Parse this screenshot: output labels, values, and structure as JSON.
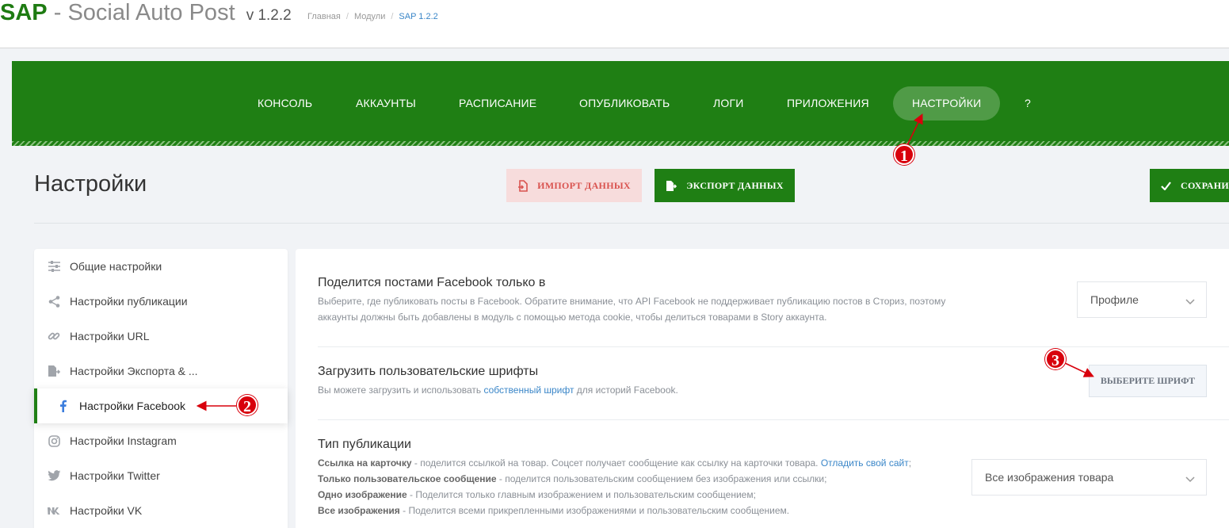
{
  "header": {
    "brand": "SAP",
    "separator": "-",
    "name": "Social Auto Post",
    "version": "v 1.2.2",
    "breadcrumb": [
      "Главная",
      "Модули",
      "SAP 1.2.2"
    ]
  },
  "nav": {
    "items": [
      "КОНСОЛЬ",
      "АККАУНТЫ",
      "РАСПИСАНИЕ",
      "ОПУБЛИКОВАТЬ",
      "ЛОГИ",
      "ПРИЛОЖЕНИЯ",
      "НАСТРОЙКИ",
      "?"
    ],
    "active": "НАСТРОЙКИ"
  },
  "page": {
    "title": "Настройки",
    "import_label": "ИМПОРТ ДАННЫХ",
    "export_label": "ЭКСПОРТ ДАННЫХ",
    "save_label": "СОХРАНИ"
  },
  "sidebar": {
    "items": [
      {
        "label": "Общие настройки",
        "icon": "sliders-icon"
      },
      {
        "label": "Настройки публикации",
        "icon": "share-icon"
      },
      {
        "label": "Настройки URL",
        "icon": "link-icon"
      },
      {
        "label": "Настройки Экспорта & ...",
        "icon": "file-export-icon"
      },
      {
        "label": "Настройки Facebook",
        "icon": "facebook-icon"
      },
      {
        "label": "Настройки Instagram",
        "icon": "instagram-icon"
      },
      {
        "label": "Настройки Twitter",
        "icon": "twitter-icon"
      },
      {
        "label": "Настройки VK",
        "icon": "vk-icon"
      }
    ],
    "active": "Настройки Facebook"
  },
  "settings": {
    "share_only": {
      "title": "Поделится постами Facebook только в",
      "desc_line1": "Выберите, где публиковать посты в Facebook. Обратите внимание, что API Facebook не поддерживает публикацию постов в Сториз, поэтому",
      "desc_line2": "аккаунты должны быть добавлены в модуль с помощью метода cookie, чтобы делиться товарами в Story аккаунта.",
      "value": "Профиле"
    },
    "fonts": {
      "title": "Загрузить пользовательские шрифты",
      "desc_before": "Вы можете загрузить и использовать ",
      "desc_link": "собственный шрифт",
      "desc_after": " для историй Facebook.",
      "button": "ВЫБЕРИТЕ ШРИФТ"
    },
    "publication_type": {
      "title": "Тип публикации",
      "lines": [
        {
          "bold": "Ссылка на карточку",
          "text": " - поделится ссылкой на товар. Соцсет получает сообщение как ссылку на карточки товара. ",
          "link": "Отладить свой сайт",
          "tail": ";"
        },
        {
          "bold": "Только пользовательское сообщение",
          "text": " - поделится пользовательским сообщением без изображения или ссылки;"
        },
        {
          "bold": "Одно изображение",
          "text": " - Поделится только главным изображением и пользовательским сообщением;"
        },
        {
          "bold": "Все изображения",
          "text": " - Поделится всеми прикрепленными изображениями и пользовательским сообщением."
        }
      ],
      "value": "Все изображения товара"
    }
  },
  "annotations": [
    "1",
    "2",
    "3"
  ],
  "colors": {
    "brand_green": "#1f7f14",
    "import_bg": "#f7dcdc",
    "import_text": "#d9534f",
    "link_blue": "#3a86c8",
    "annotation_red": "#d8000c"
  }
}
